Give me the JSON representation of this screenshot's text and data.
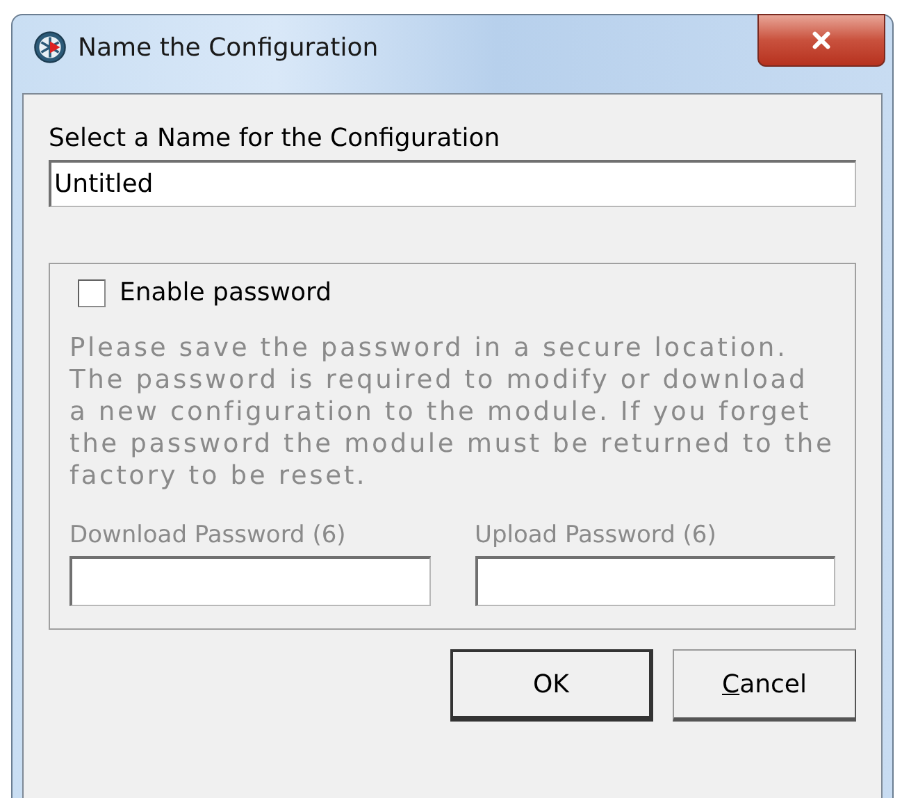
{
  "window": {
    "title": "Name the Configuration"
  },
  "name_label": "Select a Name for the Configuration",
  "name_field": {
    "value": "Untitled"
  },
  "password_group": {
    "enable_checkbox": {
      "label": "Enable password",
      "checked": false
    },
    "note": "Please save the password in a secure location. The password is required to modify or download a new configuration to the module. If you forget the password the module must be returned to the factory to be reset.",
    "disabled": true,
    "fields": [
      {
        "label": "Download Password (6)"
      },
      {
        "label": "Upload Password (6)"
      }
    ]
  },
  "buttons": [
    {
      "label": "OK",
      "default": true,
      "first_letter_underlined": false
    },
    {
      "label": "Cancel",
      "default": false,
      "first_letter_underlined": true
    }
  ]
}
